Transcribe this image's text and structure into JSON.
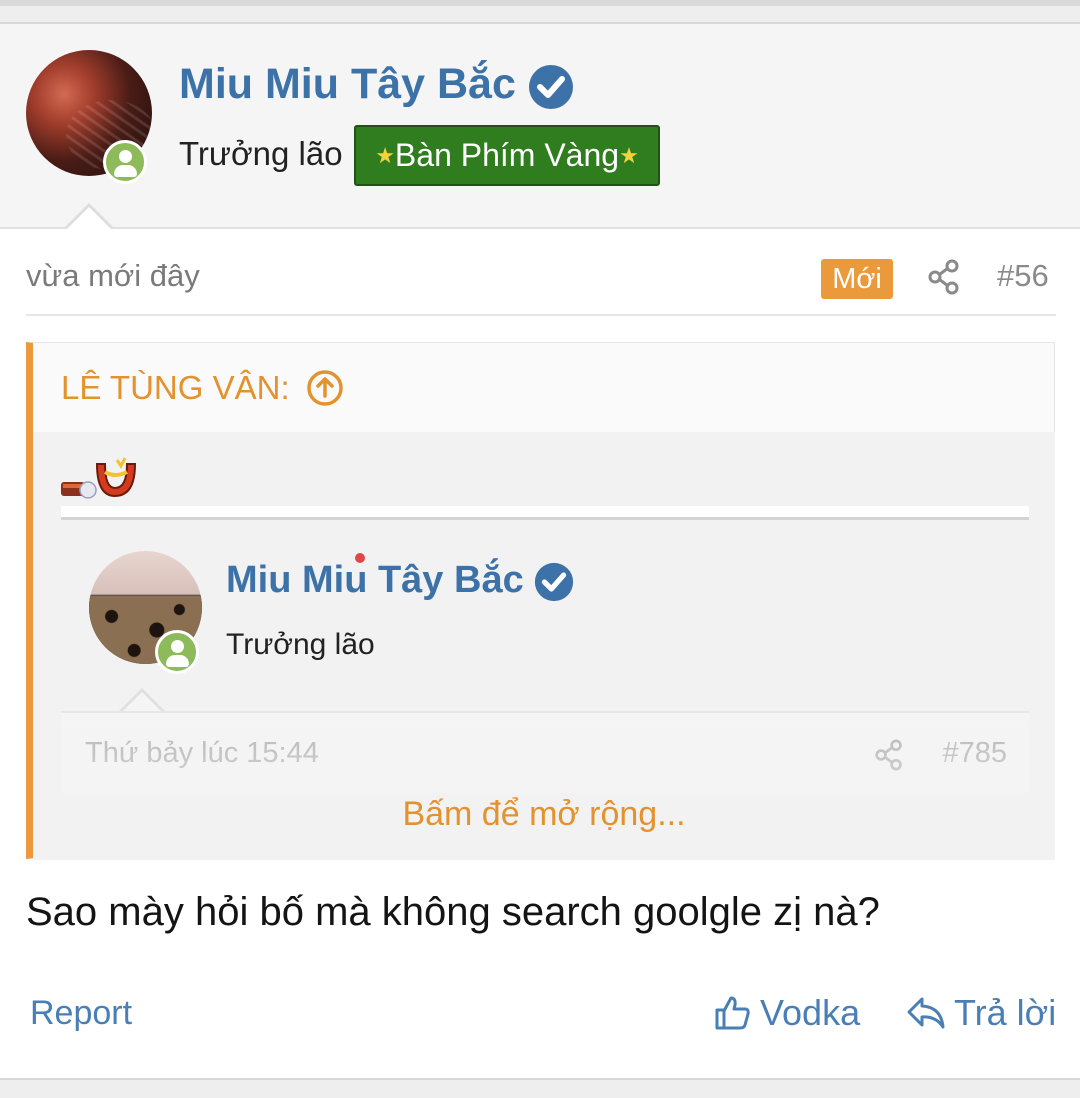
{
  "post": {
    "author": {
      "name": "Miu Miu Tây Bắc",
      "title": "Trưởng lão",
      "banner": "Bàn Phím Vàng"
    },
    "meta": {
      "time": "vừa mới đây",
      "new_badge": "Mới",
      "post_number": "#56"
    },
    "quote": {
      "attribution": "LÊ TÙNG VÂN:",
      "nested": {
        "author_name": "Miu Miu Tây Bắc",
        "author_title": "Trưởng lão",
        "time": "Thứ bảy lúc 15:44",
        "post_number": "#785"
      },
      "expand_label": "Bấm để mở rộng..."
    },
    "message": "Sao mày hỏi bố mà không search goolgle zị nà?",
    "actions": {
      "report": "Report",
      "like": "Vodka",
      "reply": "Trả lời"
    }
  },
  "icons": {
    "verified": "verified-check-icon",
    "online": "online-status-icon",
    "share": "share-icon",
    "jump_up": "arrow-up-circle-icon",
    "like": "thumbs-up-icon",
    "reply": "reply-arrow-icon"
  },
  "colors": {
    "username": "#3d72a8",
    "accent_orange": "#ea9a3b",
    "banner_green": "#2f7d1e",
    "link_blue": "#4a7fb5",
    "online_green": "#8dbb5b"
  }
}
